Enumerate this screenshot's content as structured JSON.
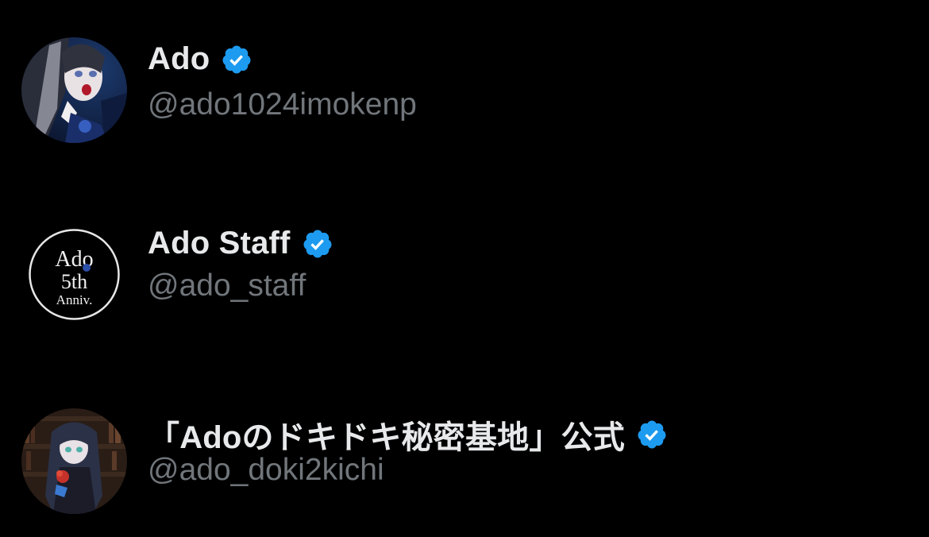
{
  "users": [
    {
      "display_name": "Ado",
      "handle": "@ado1024imokenp",
      "verified": true,
      "avatar_icon": "avatar-anime-girl-icon"
    },
    {
      "display_name": "Ado Staff",
      "handle": "@ado_staff",
      "verified": true,
      "avatar_icon": "avatar-5th-anniversary-logo-icon",
      "avatar_text": [
        "Ado",
        "5th",
        "Anniv."
      ]
    },
    {
      "display_name": "「Adoのドキドキ秘密基地」公式",
      "handle": "@ado_doki2kichi",
      "verified": true,
      "avatar_icon": "avatar-anime-girl-bookshelf-icon"
    }
  ],
  "colors": {
    "background": "#000000",
    "name_text": "#e7e9ea",
    "handle_text": "#71767b",
    "verified_badge": "#1d9bf0"
  }
}
